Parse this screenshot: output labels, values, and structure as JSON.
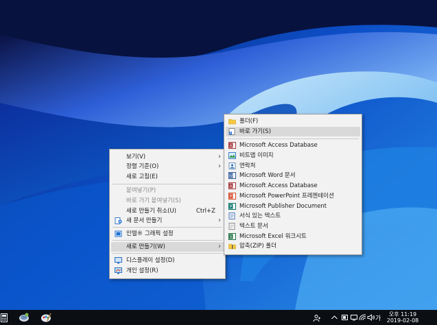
{
  "desktop_menu": {
    "items": [
      {
        "label": "보기(V)",
        "submenu": true
      },
      {
        "label": "정렬 기준(O)",
        "submenu": true
      },
      {
        "label": "새로 고침(E)"
      },
      {
        "label": "붙여넣기(P)",
        "disabled": true
      },
      {
        "label": "바로 가기 붙여넣기(S)",
        "disabled": true
      },
      {
        "label": "새로 만들기 취소(U)",
        "shortcut": "Ctrl+Z"
      },
      {
        "label": "새 문서 만들기",
        "submenu": true,
        "icon": "new-document-icon"
      },
      {
        "label": "인텔® 그래픽 설정",
        "icon": "intel-graphics-icon"
      },
      {
        "label": "새로 만들기(W)",
        "submenu": true,
        "highlighted": true
      },
      {
        "label": "디스플레이 설정(D)",
        "icon": "display-settings-icon"
      },
      {
        "label": "개인 설정(R)",
        "icon": "personalize-icon"
      }
    ]
  },
  "new_submenu": {
    "items": [
      {
        "label": "폴더(F)",
        "icon": "folder-icon"
      },
      {
        "label": "바로 가기(S)",
        "icon": "shortcut-icon",
        "highlighted": true
      },
      {
        "label": "Microsoft Access Database",
        "icon": "access-icon"
      },
      {
        "label": "비트맵 이미지",
        "icon": "bitmap-icon"
      },
      {
        "label": "연락처",
        "icon": "contact-icon"
      },
      {
        "label": "Microsoft Word 문서",
        "icon": "word-icon"
      },
      {
        "label": "Microsoft Access Database",
        "icon": "access-icon"
      },
      {
        "label": "Microsoft PowerPoint 프레젠테이션",
        "icon": "powerpoint-icon"
      },
      {
        "label": "Microsoft Publisher Document",
        "icon": "publisher-icon"
      },
      {
        "label": "서식 있는 텍스트",
        "icon": "rich-text-icon"
      },
      {
        "label": "텍스트 문서",
        "icon": "text-document-icon"
      },
      {
        "label": "Microsoft Excel 워크시트",
        "icon": "excel-icon"
      },
      {
        "label": "압축(ZIP) 폴더",
        "icon": "zip-folder-icon"
      }
    ]
  },
  "taskbar": {
    "ime": "가",
    "clock_period": "오후 11:19",
    "clock_date": "2019-02-08"
  },
  "colors": {
    "menu_bg": "#f2f2f2",
    "highlight": "#d9d9d9",
    "taskbar": "#0b0f14"
  }
}
